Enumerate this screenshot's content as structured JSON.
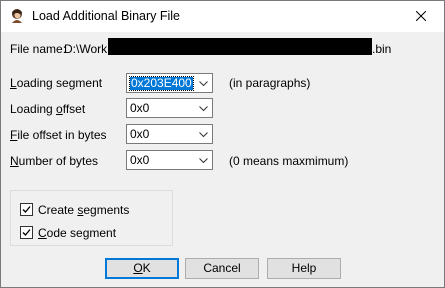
{
  "dialog": {
    "title": "Load Additional Binary File",
    "icon": "app-icon",
    "close_icon": "close-icon"
  },
  "file_name": {
    "label": "File name:",
    "prefix": "D:\\Work",
    "suffix": ".bin"
  },
  "fields": {
    "loading_segment": {
      "label_u": "L",
      "label_rest": "oading segment",
      "value": "0x203E400",
      "note": "(in paragraphs)"
    },
    "loading_offset": {
      "label_pre": "Loading ",
      "label_u": "o",
      "label_rest": "ffset",
      "value": "0x0"
    },
    "file_offset": {
      "label_u": "F",
      "label_rest": "ile offset in bytes",
      "value": "0x0"
    },
    "number_of_bytes": {
      "label_u": "N",
      "label_rest": "umber of bytes",
      "value": "0x0",
      "note": "(0 means maxmimum)"
    }
  },
  "options": {
    "create_segments": {
      "label_pre": "Create ",
      "label_u": "s",
      "label_rest": "egments",
      "checked": true
    },
    "code_segment": {
      "label_u": "C",
      "label_rest": "ode segment",
      "checked": true
    }
  },
  "buttons": {
    "ok_u": "O",
    "ok_rest": "K",
    "cancel": "Cancel",
    "help": "Help"
  },
  "colors": {
    "accent": "#0078d7",
    "background": "#f0f0f0"
  }
}
